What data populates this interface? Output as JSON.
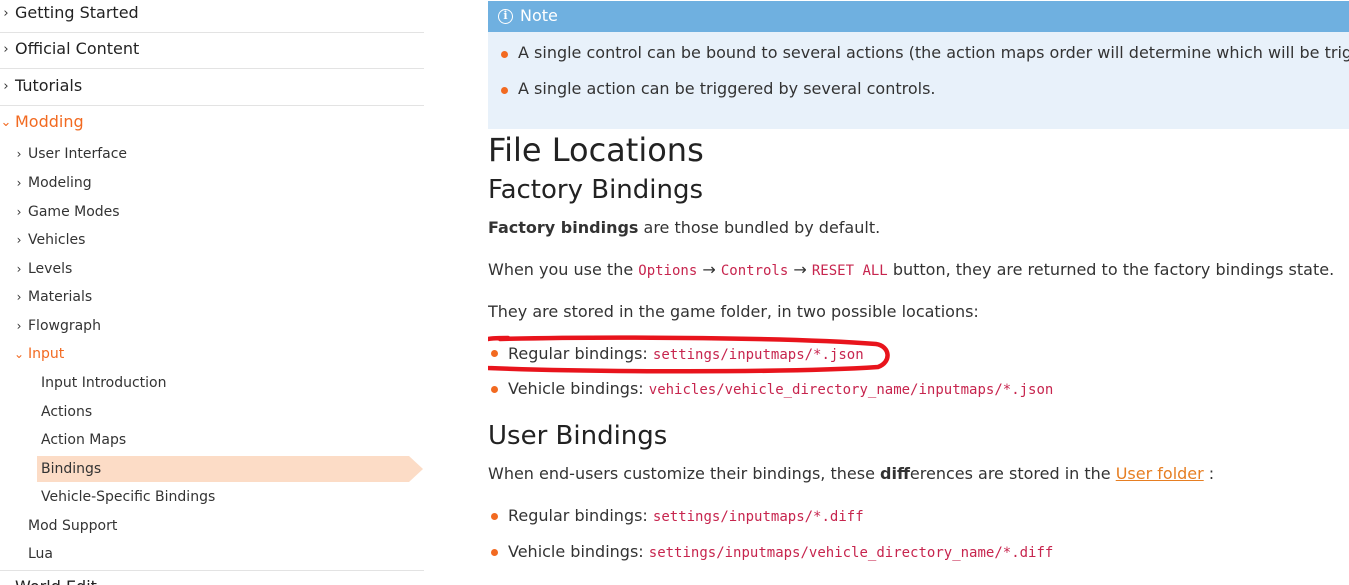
{
  "sidebar": {
    "top_items": [
      {
        "label": "Getting Started"
      },
      {
        "label": "Official Content"
      },
      {
        "label": "Tutorials"
      },
      {
        "label": "Modding"
      }
    ],
    "modding_children": [
      {
        "label": "User Interface"
      },
      {
        "label": "Modeling"
      },
      {
        "label": "Game Modes"
      },
      {
        "label": "Vehicles"
      },
      {
        "label": "Levels"
      },
      {
        "label": "Materials"
      },
      {
        "label": "Flowgraph"
      },
      {
        "label": "Input"
      }
    ],
    "input_children": [
      {
        "label": "Input Introduction"
      },
      {
        "label": "Actions"
      },
      {
        "label": "Action Maps"
      },
      {
        "label": "Bindings"
      },
      {
        "label": "Vehicle-Specific Bindings"
      }
    ],
    "after_items": [
      {
        "label": "Mod Support"
      },
      {
        "label": "Lua"
      }
    ],
    "partial_label": "World Edit"
  },
  "note": {
    "title": "Note",
    "items": [
      "A single control can be bound to several actions (the action maps order will determine which will be triggered).",
      "A single action can be triggered by several controls."
    ]
  },
  "content": {
    "title": "File Locations",
    "factory": {
      "heading": "Factory Bindings",
      "intro_bold": "Factory bindings",
      "intro_rest": " are those bundled by default.",
      "reset_pre": "When you use the ",
      "reset_code1": "Options",
      "reset_arrow1": " → ",
      "reset_code2": "Controls",
      "reset_arrow2": " → ",
      "reset_code3": "RESET ALL",
      "reset_post": " button, they are returned to the factory bindings state.",
      "stored": "They are stored in the game folder, in two possible locations:",
      "items": [
        {
          "label": "Regular bindings: ",
          "path": "settings/inputmaps/*.json"
        },
        {
          "label": "Vehicle bindings: ",
          "path": "vehicles/vehicle_directory_name/inputmaps/*.json"
        }
      ]
    },
    "user": {
      "heading": "User Bindings",
      "pre": "When end-users customize their bindings, these ",
      "bold": "diff",
      "post": "erences are stored in the ",
      "link": "User folder",
      "tail": " :",
      "items": [
        {
          "label": "Regular bindings: ",
          "path": "settings/inputmaps/*.diff"
        },
        {
          "label": "Vehicle bindings: ",
          "path": "settings/inputmaps/vehicle_directory_name/*.diff"
        }
      ]
    }
  },
  "colors": {
    "accent": "#f26a21",
    "code": "#c7254e",
    "note_header": "#6fb0e0",
    "note_body": "#e8f1fa",
    "selected_bg": "#fcdcc6",
    "annotation": "#e8141c"
  },
  "icons": {
    "collapsed": "chevron-right-icon",
    "expanded": "chevron-down-icon",
    "note": "info-icon"
  }
}
